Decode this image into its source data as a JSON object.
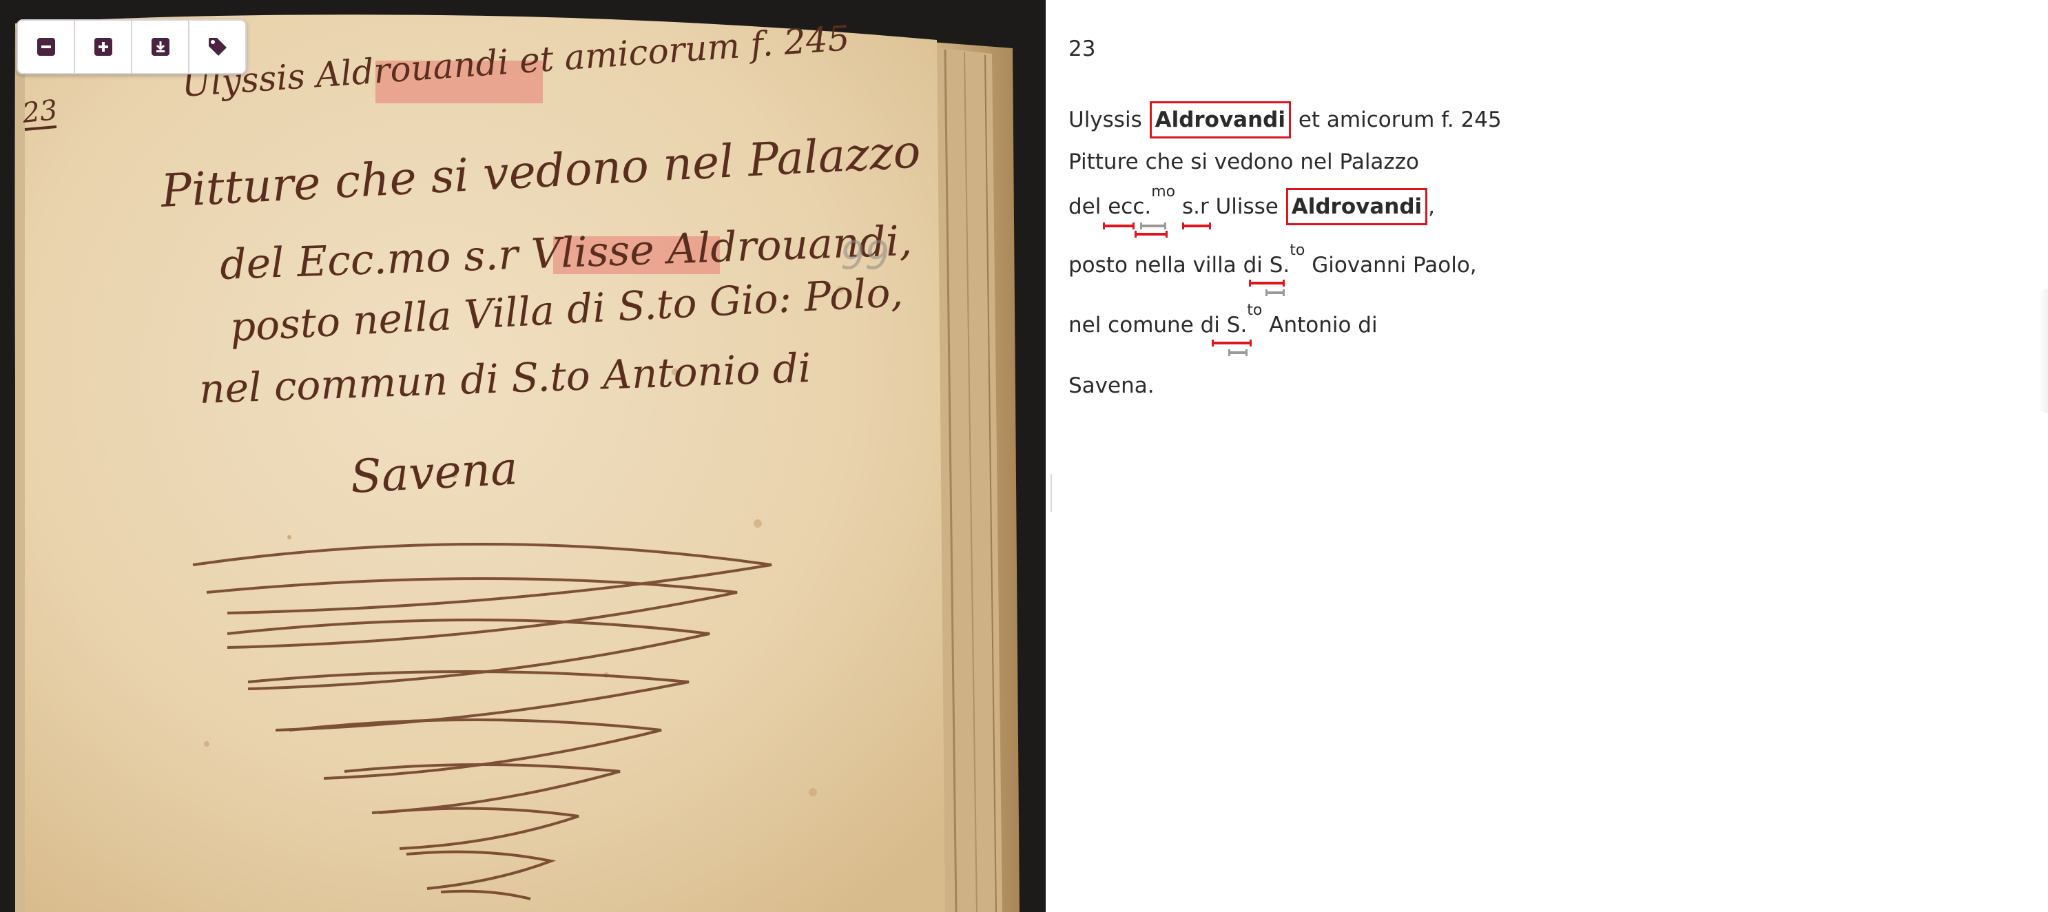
{
  "toolbar": {
    "buttons": [
      {
        "label": "Zoom out",
        "icon": "minus-square-icon"
      },
      {
        "label": "Zoom in",
        "icon": "plus-square-icon"
      },
      {
        "label": "Download",
        "icon": "download-icon"
      },
      {
        "label": "Tags",
        "icon": "tag-icon"
      }
    ]
  },
  "manuscript": {
    "folio_number": "23",
    "pencil_number": "99",
    "lines": [
      "Ulyssis Aldrouandi et amicorum f. 245",
      "Pitture che si vedono nel Palazzo",
      "del Ecc.mo s.r Vlisse Aldrouandi,",
      "posto nella Villa di S.to Gio: Polo,",
      "nel commun di S.to Antonio di",
      "Savena"
    ]
  },
  "transcription": {
    "page_number": "23",
    "line1": {
      "pre": "Ulyssis",
      "entity": "Aldrovandi",
      "post": "et amicorum f. 245"
    },
    "line2": "Pitture che si vedono nel Palazzo",
    "line3": {
      "pre": "del ecc.",
      "sup": "mo",
      "mid": "s.r Ulisse",
      "entity": "Aldrovandi",
      "post": ","
    },
    "line4": {
      "pre": "posto nella villa di S.",
      "sup": "to",
      "post": "Giovanni Paolo,"
    },
    "line5": {
      "pre": "nel comune di S.",
      "sup": "to",
      "post": "Antonio di"
    },
    "line6": "Savena."
  },
  "colors": {
    "entity_border": "#e0141c",
    "entity_highlight": "#e8736c",
    "toolbar_icon": "#4a2340",
    "abbreviation_marker_primary": "#e0141c",
    "abbreviation_marker_secondary": "#9a9a9a"
  }
}
